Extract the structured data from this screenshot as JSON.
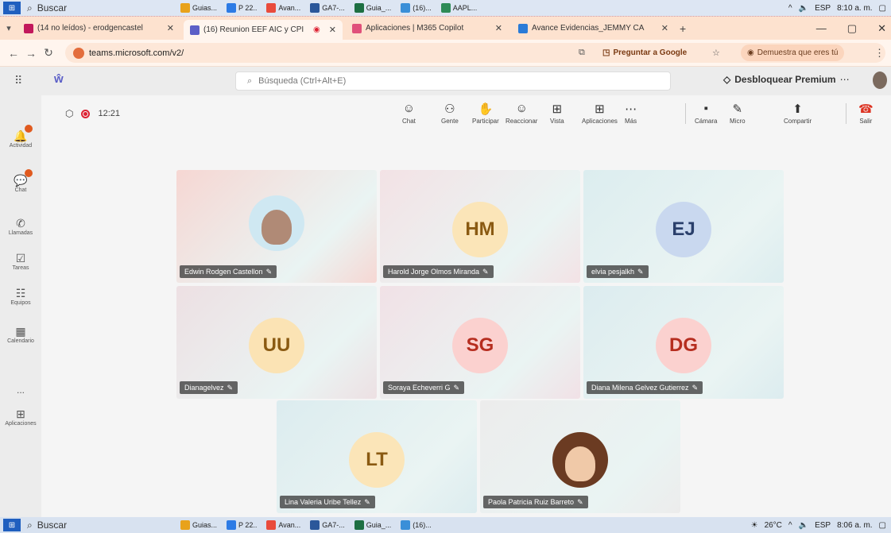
{
  "taskbar_top": {
    "search": "Buscar",
    "apps": [
      "Guias...",
      "P 22..",
      "Avan...",
      "GA7-...",
      "Guia_...",
      "(16)...",
      "AAPL..."
    ],
    "lang": "ESP",
    "time": "8:10 a. m."
  },
  "browser": {
    "tabs": [
      {
        "label": "(14 no leídos) - erodgencastel",
        "color": "#c2185b"
      },
      {
        "label": "(16) Reunion EEF AIC y CPI",
        "color": "#5b5fc7"
      },
      {
        "label": "Aplicaciones | M365 Copilot",
        "color": "#e0507a"
      },
      {
        "label": "Avance Evidencias_JEMMY CA",
        "color": "#2a7bd8"
      }
    ],
    "url": "teams.microsoft.com/v2/",
    "google_btn": "Preguntar a Google",
    "profile_btn": "Demuestra que eres tú"
  },
  "teams": {
    "search_placeholder": "Búsqueda (Ctrl+Alt+E)",
    "premium": "Desbloquear Premium",
    "rail": [
      {
        "label": "Actividad",
        "icon": "bell-icon"
      },
      {
        "label": "Chat",
        "icon": "chat-icon"
      },
      {
        "label": "Llamadas",
        "icon": "phone-icon"
      },
      {
        "label": "Tareas",
        "icon": "tasks-icon"
      },
      {
        "label": "Equipos",
        "icon": "teams-icon"
      },
      {
        "label": "Calendario",
        "icon": "calendar-icon"
      },
      {
        "label": "...",
        "icon": "more-icon"
      },
      {
        "label": "Aplicaciones",
        "icon": "apps-icon"
      }
    ],
    "timer": "12:21",
    "toolbar": [
      {
        "label": "Chat",
        "glyph": "☺"
      },
      {
        "label": "Gente",
        "glyph": "⚇"
      },
      {
        "label": "Participar",
        "glyph": "✋"
      },
      {
        "label": "Reaccionar",
        "glyph": "☺"
      },
      {
        "label": "Vista",
        "glyph": "⊞"
      },
      {
        "label": "Aplicaciones",
        "glyph": "⊞"
      },
      {
        "label": "Más",
        "glyph": "⋯"
      },
      {
        "label": "Cámara",
        "glyph": "▪"
      },
      {
        "label": "Micro",
        "glyph": "✎"
      },
      {
        "label": "Compartir",
        "glyph": "⬆"
      },
      {
        "label": "Salir",
        "glyph": "☎"
      }
    ],
    "participants": [
      {
        "name": "Edwin Rodgen Castellon",
        "initials": "",
        "photo": true,
        "bg": "#f6d7d3",
        "av": "#cfe8f2",
        "fg": "#333"
      },
      {
        "name": "Harold Jorge Olmos Miranda",
        "initials": "HM",
        "photo": false,
        "bg": "#f3e2e5",
        "av": "#fbe5b8",
        "fg": "#8a5a12"
      },
      {
        "name": "elvia pesjalkh",
        "initials": "EJ",
        "photo": false,
        "bg": "#dcedef",
        "av": "#c9d8ef",
        "fg": "#2a3f6b"
      },
      {
        "name": "Dianagelvez",
        "initials": "UU",
        "photo": false,
        "bg": "#ede0e3",
        "av": "#fbe3b4",
        "fg": "#8a5a12"
      },
      {
        "name": "Soraya Echeverri G",
        "initials": "SG",
        "photo": false,
        "bg": "#f1e1e6",
        "av": "#fbd1cf",
        "fg": "#b62d1f"
      },
      {
        "name": "Diana Milena Gelvez Gutierrez",
        "initials": "DG",
        "photo": false,
        "bg": "#dcecef",
        "av": "#fbd1cf",
        "fg": "#b62d1f"
      },
      {
        "name": "Lina Valeria Uribe Tellez",
        "initials": "LT",
        "photo": false,
        "bg": "#dcecef",
        "av": "#fbe5b8",
        "fg": "#8a5a12"
      },
      {
        "name": "Paola Patricia Ruiz Barreto",
        "initials": "",
        "photo": true,
        "bg": "#ececec",
        "av": "#6b3b22",
        "fg": "#fff"
      }
    ]
  },
  "taskbar_bottom": {
    "search": "Buscar",
    "apps": [
      "Guias...",
      "P 22..",
      "Avan...",
      "GA7-...",
      "Guia_...",
      "(16)..."
    ],
    "weather": "26°C",
    "lang": "ESP",
    "time": "8:06 a. m."
  }
}
